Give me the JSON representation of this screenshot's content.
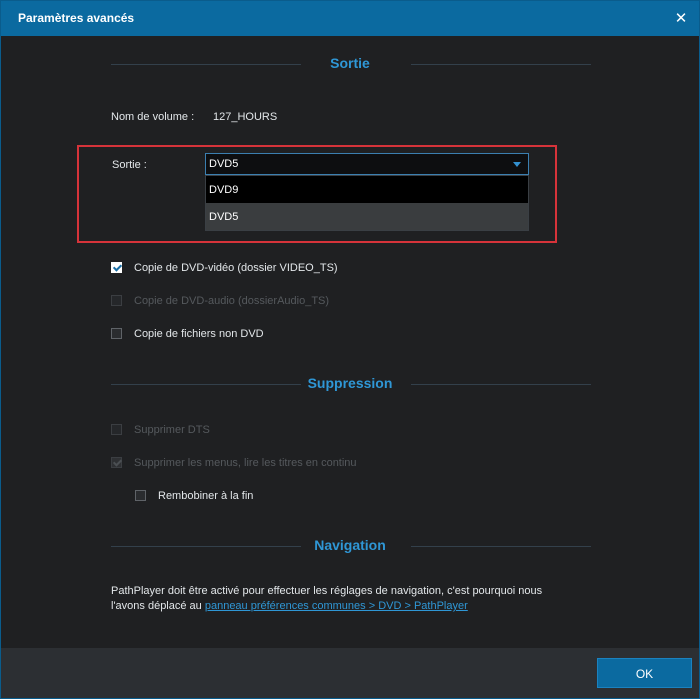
{
  "window": {
    "title": "Paramètres avancés"
  },
  "sections": {
    "sortie": "Sortie",
    "suppression": "Suppression",
    "navigation": "Navigation"
  },
  "volume": {
    "label": "Nom de volume :",
    "value": "127_HOURS"
  },
  "output": {
    "label": "Sortie :",
    "selected": "DVD5",
    "options": [
      "DVD9",
      "DVD5"
    ],
    "highlighted_option": "DVD5"
  },
  "copy_options": [
    {
      "label": "Copie de DVD-vidéo (dossier VIDEO_TS)",
      "checked": true,
      "enabled": true
    },
    {
      "label": "Copie de DVD-audio (dossierAudio_TS)",
      "checked": false,
      "enabled": false
    },
    {
      "label": "Copie de fichiers non DVD",
      "checked": false,
      "enabled": true
    }
  ],
  "suppression_options": [
    {
      "label": "Supprimer DTS",
      "checked": false,
      "enabled": false
    },
    {
      "label": "Supprimer les menus, lire les titres en continu",
      "checked": true,
      "enabled": false
    },
    {
      "label": "Rembobiner à la fin",
      "checked": false,
      "enabled": true
    }
  ],
  "navigation": {
    "text_line1": "PathPlayer doit être activé pour effectuer les réglages de navigation, c'est pourquoi nous",
    "text_line2_prefix": "l'avons déplacé au ",
    "link_text": "panneau préférences communes > DVD > PathPlayer"
  },
  "footer": {
    "ok_label": "OK"
  },
  "colors": {
    "accent": "#0b6aa0",
    "section_title": "#2f97d6",
    "highlight_border": "#d6333a"
  }
}
